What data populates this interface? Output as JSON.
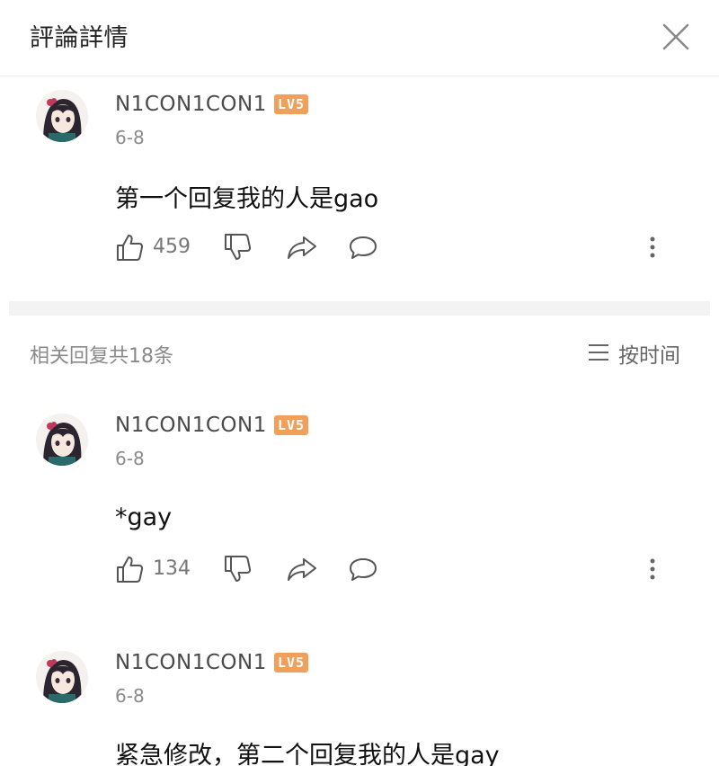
{
  "header": {
    "title": "評論詳情",
    "close_icon": "close-icon"
  },
  "main_comment": {
    "username": "N1CON1CON1",
    "level": "LV5",
    "date": "6-8",
    "content": "第一个回复我的人是gao",
    "likes": "459"
  },
  "replies_header": {
    "count_label": "相关回复共18条",
    "sort_label": "按时间"
  },
  "replies": [
    {
      "username": "N1CON1CON1",
      "level": "LV5",
      "date": "6-8",
      "content": "*gay",
      "likes": "134"
    },
    {
      "username": "N1CON1CON1",
      "level": "LV5",
      "date": "6-8",
      "content": "紧急修改，第二个回复我的人是gay"
    }
  ],
  "colors": {
    "level_badge": "#f0a05a",
    "divider": "#f3f3f3",
    "secondary_text": "#8a8a8a"
  }
}
